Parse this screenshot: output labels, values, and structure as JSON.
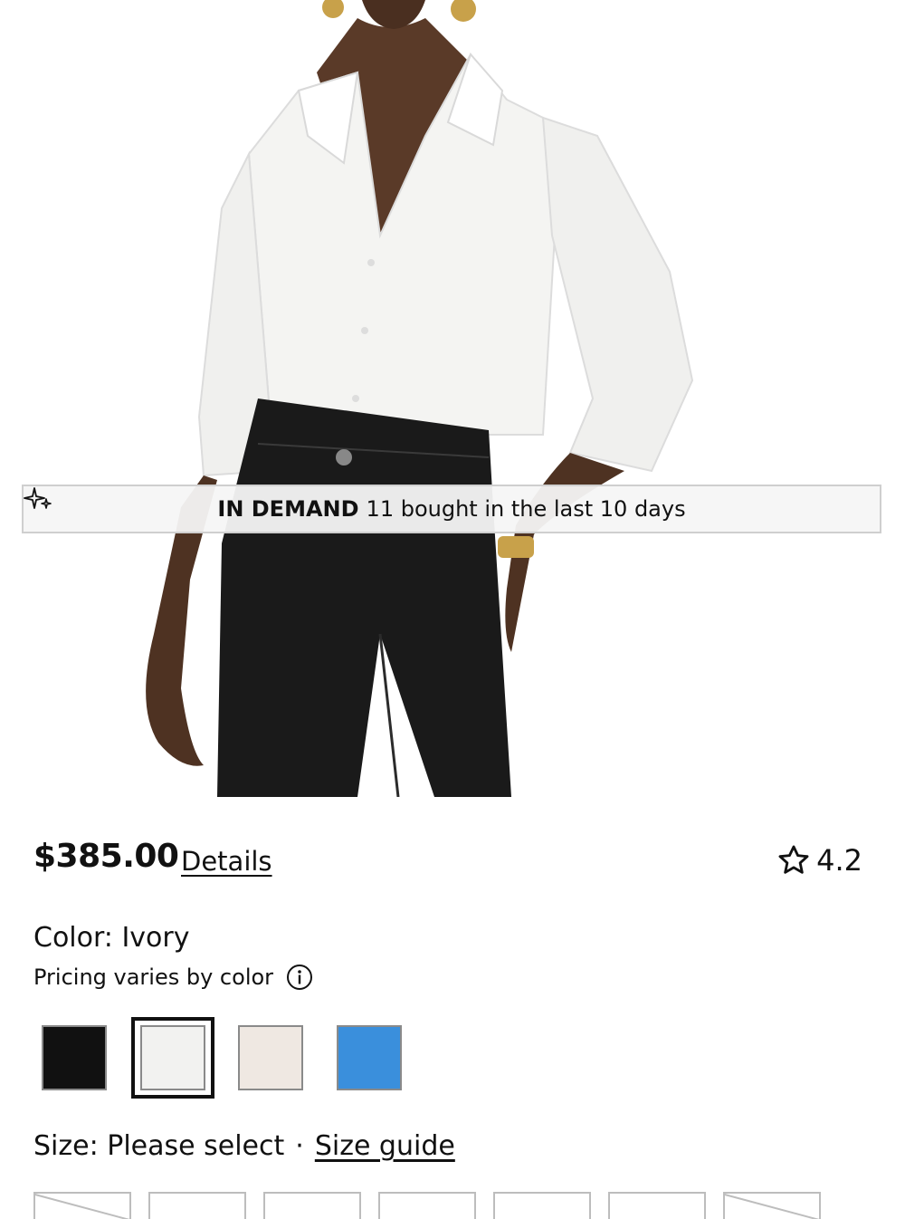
{
  "banner": {
    "icon": "sparkle-icon",
    "highlight": "IN DEMAND",
    "text": "11 bought in the last 10 days"
  },
  "product": {
    "image_alt": "Model wearing ivory silk button-down shirt with black coated jeans",
    "price": "$385.00",
    "details_label": "Details",
    "rating": "4.2",
    "rating_icon": "star-outline-icon"
  },
  "color": {
    "label": "Color: Ivory",
    "pricing_note": "Pricing varies by color",
    "swatches": [
      {
        "name": "Black",
        "hex": "#111111"
      },
      {
        "name": "Ivory",
        "hex": "#f2f2f0",
        "selected": true
      },
      {
        "name": "Cream",
        "hex": "#efe8e2"
      },
      {
        "name": "Blue",
        "hex": "#3a8fdc"
      }
    ]
  },
  "size": {
    "label": "Size: Please select",
    "separator": "·",
    "guide_label": "Size guide",
    "options_visible": 7
  },
  "colors": {
    "text": "#111111",
    "banner_bg": "#f5f5f5",
    "border": "#bdbdbd"
  }
}
